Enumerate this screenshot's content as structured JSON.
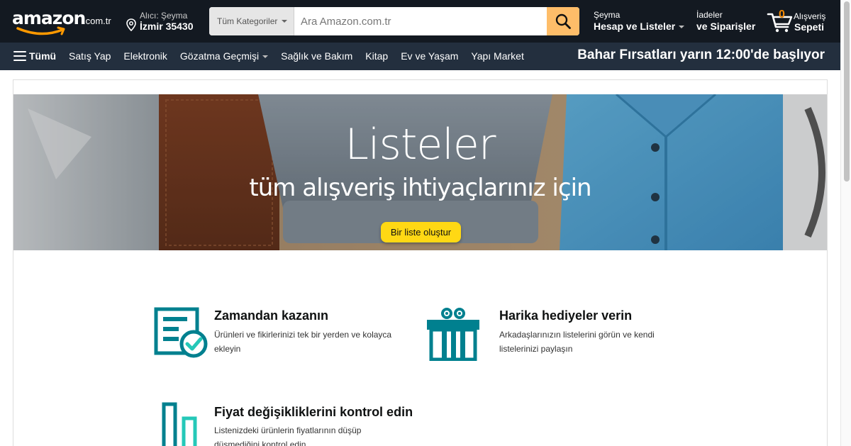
{
  "header": {
    "logo_text": "amazon",
    "logo_tld": ".com.tr",
    "deliver_line1": "Alıcı: Şeyma",
    "deliver_line2": "İzmir 35430",
    "search": {
      "category": "Tüm Kategoriler",
      "placeholder": "Ara Amazon.com.tr",
      "value": ""
    },
    "account_line1": "Şeyma",
    "account_line2": "Hesap ve Listeler",
    "orders_line1": "İadeler",
    "orders_line2": "ve Siparişler",
    "cart_count": "0",
    "cart_line1": "Alışveriş",
    "cart_line2": "Sepeti"
  },
  "subnav": {
    "all_label": "Tümü",
    "links": [
      "Satış Yap",
      "Elektronik",
      "Gözatma Geçmişi",
      "Sağlık ve Bakım",
      "Kitap",
      "Ev ve Yaşam",
      "Yapı Market"
    ],
    "promo": "Bahar Fırsatları yarın 12:00'de başlıyor"
  },
  "hero": {
    "title": "Listeler",
    "subtitle": "tüm alışveriş ihtiyaçlarınız için",
    "button": "Bir liste oluştur"
  },
  "features": [
    {
      "icon": "list-check-icon",
      "title": "Zamandan kazanın",
      "desc": "Ürünleri ve fikirlerinizi tek bir yerden ve kolayca ekleyin"
    },
    {
      "icon": "gift-icon",
      "title": "Harika hediyeler verin",
      "desc": "Arkadaşlarınızın listelerini görün ve kendi listelerinizi paylaşın"
    },
    {
      "icon": "price-chart-icon",
      "title": "Fiyat değişikliklerini kontrol edin",
      "desc": "Listenizdeki ürünlerin fiyatlarının düşüp düşmediğini kontrol edin"
    }
  ],
  "colors": {
    "nav_top": "#131921",
    "nav_sub": "#232f3e",
    "search_button": "#febd69",
    "cart_count": "#f08804",
    "hero_button": "#ffd814",
    "icon_teal": "#00808f",
    "icon_teal_light": "#25c8b8"
  }
}
